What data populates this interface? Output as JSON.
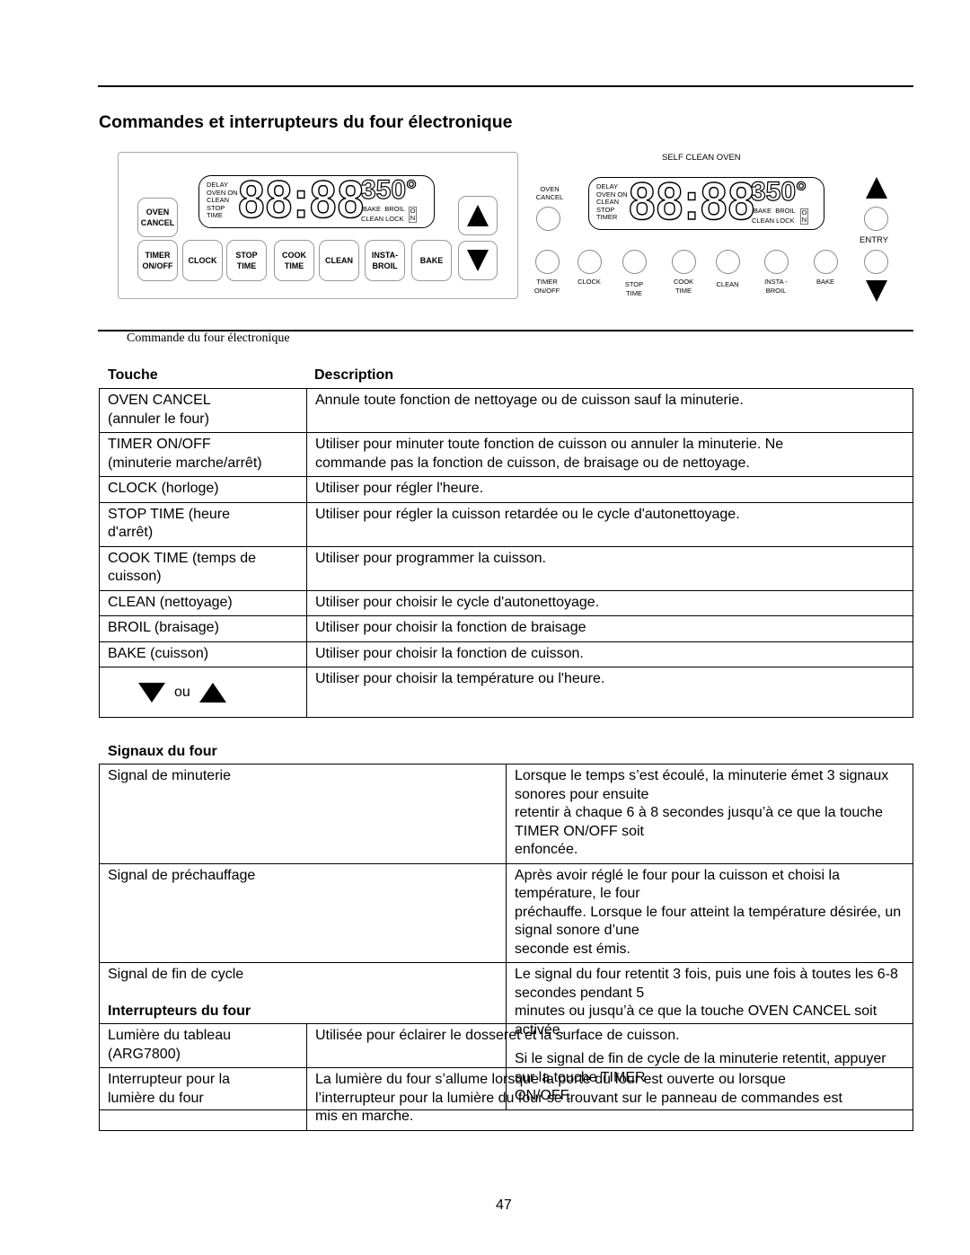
{
  "title": "Commandes et interrupteurs du four électronique",
  "panel1": {
    "display_labels_left": [
      "DELAY",
      "OVEN ON",
      "CLEAN",
      "STOP",
      "TIME"
    ],
    "digits": "88:88",
    "temp": "350°",
    "bake": "BAKE",
    "broil": "BROIL",
    "clean_lock": "CLEAN LOCK",
    "on_o": "O",
    "on_n": "N",
    "keys": {
      "oven_cancel": [
        "OVEN",
        "CANCEL"
      ],
      "timer": [
        "TIMER",
        "ON/OFF"
      ],
      "clock": [
        "CLOCK"
      ],
      "stop": [
        "STOP",
        "TIME"
      ],
      "cook": [
        "COOK",
        "TIME"
      ],
      "clean": [
        "CLEAN"
      ],
      "insta": [
        "INSTA-",
        "BROIL"
      ],
      "bake": [
        "BAKE"
      ]
    }
  },
  "panel2": {
    "heading": "SELF CLEAN OVEN",
    "display_labels_left": [
      "DELAY",
      "OVEN ON",
      "CLEAN",
      "STOP",
      "TIMER"
    ],
    "digits": "88:88",
    "temp": "350°",
    "bake": "BAKE",
    "broil": "BROIL",
    "clean_lock": "CLEAN LOCK",
    "on_o": "O",
    "on_n": "N",
    "oven_cancel": [
      "OVEN",
      "CANCEL"
    ],
    "entry": "ENTRY",
    "keys": [
      [
        "TIMER",
        "ON/OFF"
      ],
      [
        "CLOCK",
        ""
      ],
      [
        "STOP",
        "TIME"
      ],
      [
        "COOK",
        "TIME"
      ],
      [
        "CLEAN",
        ""
      ],
      [
        "INSTA -",
        "BROIL"
      ],
      [
        "BAKE",
        ""
      ]
    ]
  },
  "caption": "Commande du four électronique",
  "touche_header": "Touche",
  "description_header": "Description",
  "keys_table": [
    [
      "OVEN CANCEL\n(annuler le four)",
      "Annule toute fonction de nettoyage ou de cuisson sauf la minuterie."
    ],
    [
      "TIMER ON/OFF\n(minuterie marche/arrêt)",
      "Utiliser pour minuter toute fonction de cuisson ou annuler la minuterie.  Ne\ncommande pas la fonction de cuisson, de braisage ou de nettoyage."
    ],
    [
      "CLOCK (horloge)",
      "Utiliser pour régler l'heure."
    ],
    [
      "STOP TIME (heure\nd'arrêt)",
      "Utiliser pour régler la cuisson retardée ou le cycle d'autonettoyage."
    ],
    [
      "COOK TIME (temps de\ncuisson)",
      "Utiliser pour programmer la cuisson."
    ],
    [
      "CLEAN (nettoyage)",
      "Utiliser pour choisir le cycle d'autonettoyage."
    ],
    [
      "BROIL (braisage)",
      "Utiliser pour choisir la fonction de braisage"
    ],
    [
      "BAKE (cuisson)",
      "Utiliser pour choisir la fonction de cuisson."
    ]
  ],
  "arrows_row": {
    "ou": "ou",
    "desc": "Utiliser pour choisir la température ou l'heure."
  },
  "signaux_header": "Signaux du four",
  "signaux": [
    [
      "Signal de minuterie",
      "Lorsque le temps s’est écoulé, la minuterie émet 3 signaux sonores pour ensuite\nretentir à chaque 6 à 8 secondes jusqu’à ce que la touche TIMER ON/OFF soit\nenfoncée."
    ],
    [
      "Signal de préchauffage",
      "Après avoir réglé le four pour la cuisson et choisi la température, le four\npréchauffe. Lorsque le four atteint la température désirée, un signal sonore d’une\nseconde est émis."
    ],
    [
      "Signal de fin de cycle",
      "Le signal du four retentit 3 fois, puis une fois à toutes les 6-8 secondes pendant 5\nminutes ou jusqu’à ce que la touche OVEN CANCEL soit activée."
    ]
  ],
  "signaux_extra": "Si le signal de fin de cycle de la minuterie retentit, appuyer sur la touche TIMER\nON/OFF.",
  "interrupteurs_header": "Interrupteurs du four",
  "interrupteurs": [
    [
      "Lumière du tableau\n(ARG7800)",
      "Utilisée pour éclairer le dosseret et la surface de cuisson."
    ],
    [
      "Interrupteur pour la\nlumière du four",
      "La lumière du four s’allume lorsque la porte du four est ouverte ou lorsque\nl’interrupteur pour la lumière du four se trouvant sur le panneau de commandes est\nmis en marche."
    ]
  ],
  "page_number": "47"
}
